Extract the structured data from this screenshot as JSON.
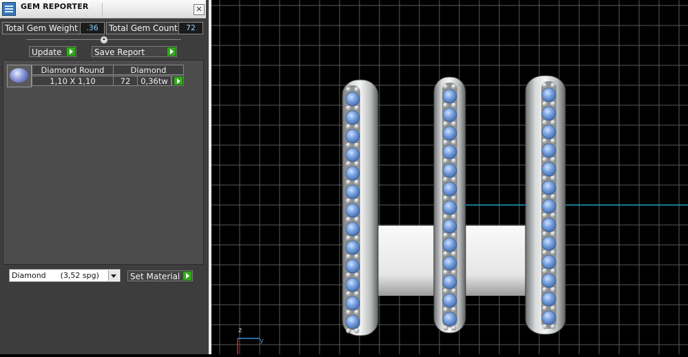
{
  "window": {
    "title": "GEM REPORTER",
    "close_glyph": "✕"
  },
  "stats": {
    "weight_label": "Total Gem Weight",
    "weight_value": ".36",
    "count_label": "Total Gem Count",
    "count_value": "72"
  },
  "actions": {
    "update_label": "Update",
    "save_label": "Save Report"
  },
  "table": {
    "headers": [
      "Diamond Round",
      "Diamond"
    ],
    "row": {
      "size": "1,10 X 1,10",
      "count": "72",
      "weight": "0,36tw"
    }
  },
  "material": {
    "selected": "Diamond      (3,52 spg)",
    "set_label": "Set Material"
  },
  "viewport": {
    "axis_z": "z",
    "axis_y": "y",
    "colors": {
      "background": "#000000",
      "grid": "#5a5a5a",
      "gem": "#6f9bd8",
      "metal": "#d8dadb",
      "axis_cyan": "#1aa5c0"
    },
    "rings": 3
  }
}
